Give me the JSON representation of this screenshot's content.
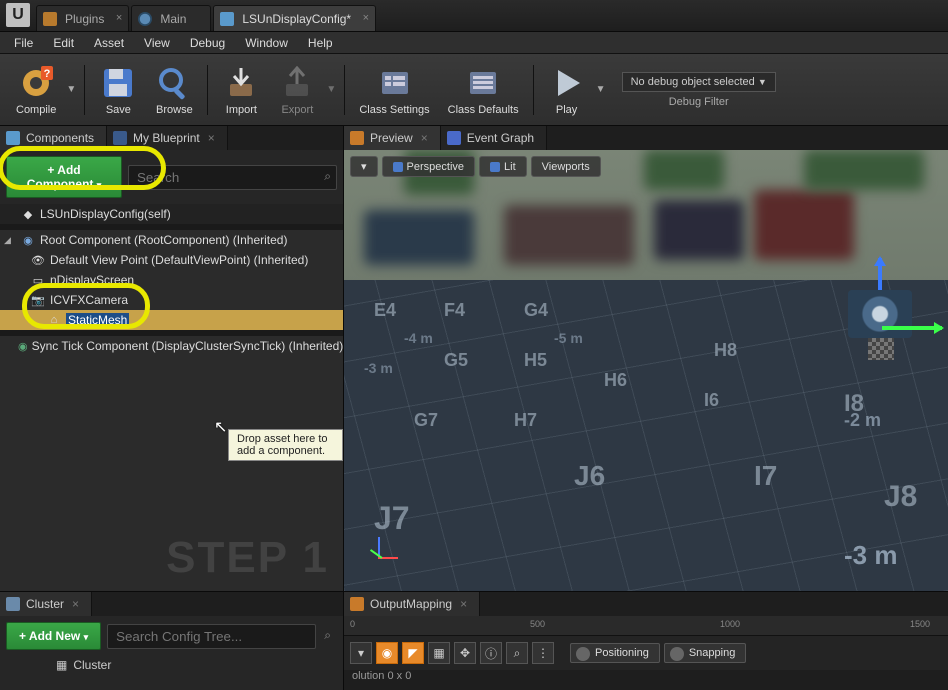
{
  "titlebar": {
    "tabs": [
      {
        "label": "Plugins"
      },
      {
        "label": "Main"
      },
      {
        "label": "LSUnDisplayConfig*"
      }
    ]
  },
  "menu": [
    "File",
    "Edit",
    "Asset",
    "View",
    "Debug",
    "Window",
    "Help"
  ],
  "toolbar": {
    "compile": "Compile",
    "save": "Save",
    "browse": "Browse",
    "import": "Import",
    "export": "Export",
    "class_settings": "Class Settings",
    "class_defaults": "Class Defaults",
    "play": "Play"
  },
  "debug": {
    "selector": "No debug object selected",
    "label": "Debug Filter"
  },
  "left_tabs": {
    "components": "Components",
    "my_blueprint": "My Blueprint"
  },
  "add_component": "+ Add Component",
  "search_placeholder": "Search",
  "tree": {
    "root_self": "LSUnDisplayConfig(self)",
    "root_comp": "Root Component (RootComponent) (Inherited)",
    "default_view": "Default View Point (DefaultViewPoint) (Inherited)",
    "ndisplay": "nDisplayScreen",
    "icvfx": "ICVFXCamera",
    "staticmesh": "StaticMesh",
    "sync": "Sync Tick Component (DisplayClusterSyncTick) (Inherited)"
  },
  "step_label": "STEP 1",
  "tooltip": "Drop asset here to add a component.",
  "viewport": {
    "tabs": {
      "preview": "Preview",
      "event_graph": "Event Graph"
    },
    "pills": {
      "perspective": "Perspective",
      "lit": "Lit",
      "viewports": "Viewports"
    },
    "grid_labels": [
      "E4",
      "F4",
      "G4",
      "H5",
      "G5",
      "H6",
      "I6",
      "J6",
      "G7",
      "H7",
      "I7",
      "J7",
      "H8",
      "I8",
      "J8"
    ],
    "depth_labels": [
      "-3 m",
      "-4 m",
      "-5 m",
      "-2 m",
      "-3 m"
    ]
  },
  "cluster": {
    "tab": "Cluster",
    "add": "+ Add New",
    "search": "Search Config Tree...",
    "item": "Cluster"
  },
  "output": {
    "tab": "OutputMapping",
    "ruler": [
      "0",
      "500",
      "1000",
      "1500"
    ],
    "positioning": "Positioning",
    "snapping": "Snapping",
    "status": "olution 0 x 0"
  }
}
